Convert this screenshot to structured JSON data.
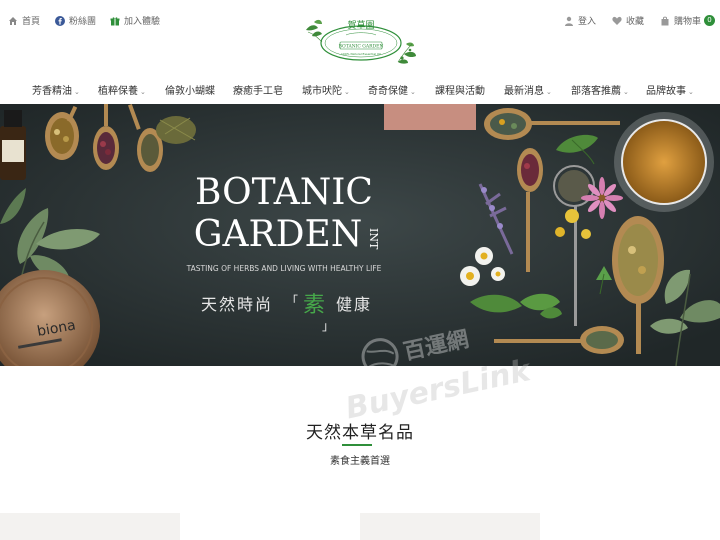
{
  "topbar": {
    "home_label": "首頁",
    "fans_label": "粉絲團",
    "join_label": "加入體驗",
    "login_label": "登入",
    "favorites_label": "收藏",
    "cart_label": "購物車",
    "cart_count": "0"
  },
  "logo": {
    "chinese": "賀草園",
    "english": "BOTANIC GARDEN",
    "tagline": "100% Natural Essential Oil"
  },
  "nav": {
    "items": [
      {
        "label": "芳香精油",
        "dropdown": true
      },
      {
        "label": "植粹保養",
        "dropdown": true
      },
      {
        "label": "倫敦小蝴蝶",
        "dropdown": false
      },
      {
        "label": "療癒手工皂",
        "dropdown": false
      },
      {
        "label": "城市吠陀",
        "dropdown": true
      },
      {
        "label": "奇奇保健",
        "dropdown": true
      },
      {
        "label": "課程與活動",
        "dropdown": false
      },
      {
        "label": "最新消息",
        "dropdown": true
      },
      {
        "label": "部落客推薦",
        "dropdown": true
      },
      {
        "label": "品牌故事",
        "dropdown": true
      }
    ]
  },
  "banner": {
    "brand_line1": "BOTANIC",
    "brand_line2": "GARDEN",
    "brand_suffix": "INT",
    "tagline": "TASTING OF HERBS AND  LIVING WITH HEALTHY LIFE",
    "slogan_before": "天然時尚",
    "slogan_highlight": "素",
    "slogan_after": "健康",
    "tin_label": "biona"
  },
  "section": {
    "title": "天然本草名品",
    "subtitle": "素食主義首選"
  },
  "watermark": {
    "line1": "百運網",
    "line2": "BuyersLink"
  },
  "colors": {
    "accent_green": "#2f8f3a",
    "banner_bg": "#2c3436"
  }
}
